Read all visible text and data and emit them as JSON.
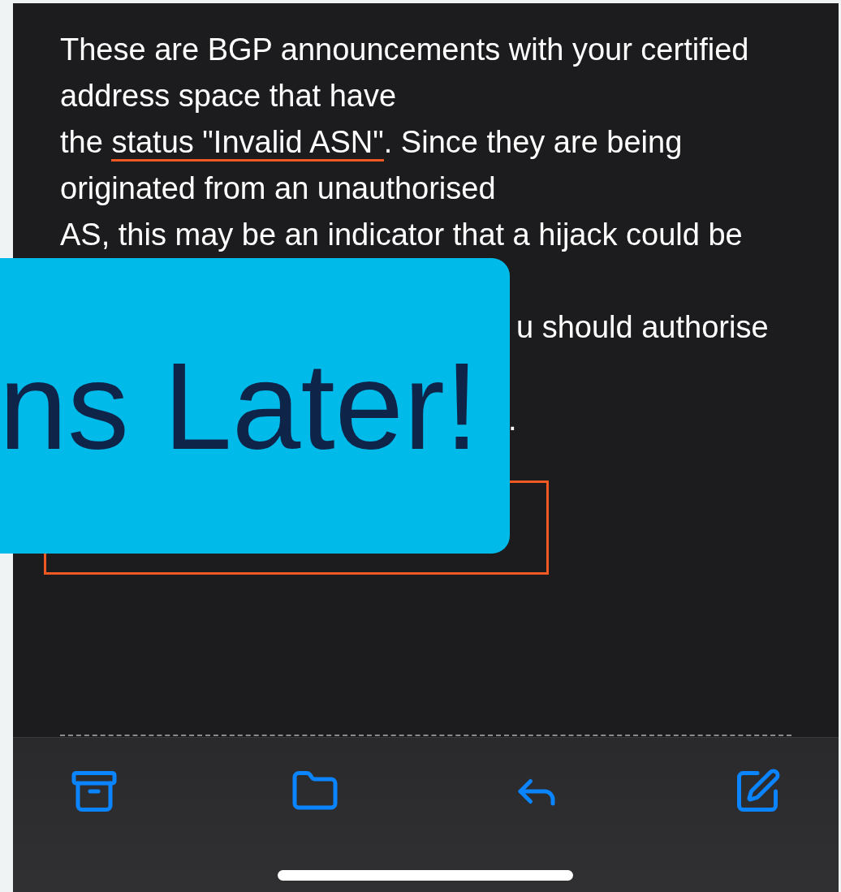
{
  "message": {
    "lines": [
      {
        "text": "These are BGP announcements with your certified"
      },
      {
        "text": "address space that have"
      },
      {
        "before": "the ",
        "underlined": "status \"Invalid ASN\"",
        "after": ". Since they are being"
      },
      {
        "text": "originated from an unauthorised"
      },
      {
        "text": "AS, this may be an indicator that a hijack could be"
      }
    ],
    "fragments": [
      {
        "text": "u should authorise"
      },
      {
        "text": "."
      }
    ]
  },
  "overlay": {
    "text": "ns Later!"
  },
  "toolbar": {
    "buttons": [
      {
        "kind": "archive"
      },
      {
        "kind": "folder"
      },
      {
        "kind": "reply"
      },
      {
        "kind": "compose"
      }
    ]
  }
}
